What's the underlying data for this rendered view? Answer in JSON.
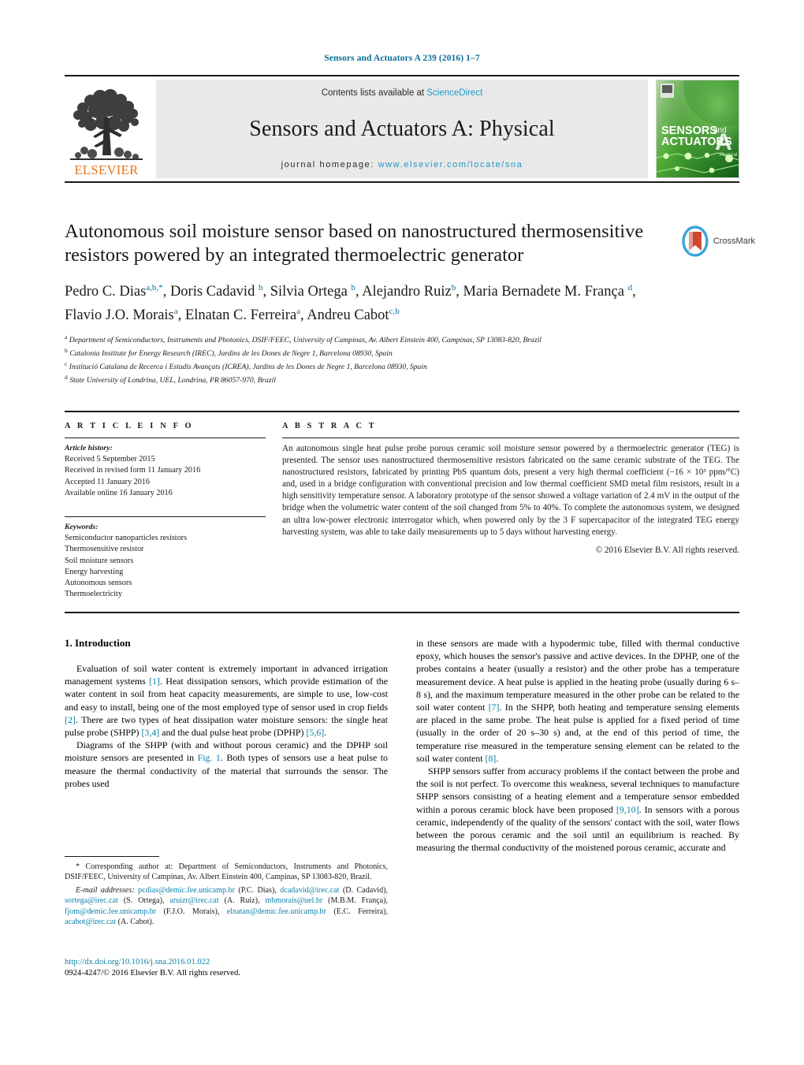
{
  "running_head": "Sensors and Actuators A 239 (2016) 1–7",
  "masthead": {
    "contents_prefix": "Contents lists available at ",
    "sciencedirect": "ScienceDirect",
    "journal_title": "Sensors and Actuators A: Physical",
    "homepage_prefix": "journal homepage:",
    "homepage_url": "www.elsevier.com/locate/sna",
    "publisher_wordmark": "ELSEVIER",
    "cover_line1": "SENSORS",
    "cover_and": "and",
    "cover_line2": "ACTUATORS",
    "cover_letter": "A",
    "cover_sub": "Physical"
  },
  "crossmark": {
    "label": "CrossMark"
  },
  "article": {
    "title": "Autonomous soil moisture sensor based on nanostructured thermosensitive resistors powered by an integrated thermoelectric generator",
    "authors_line1": "Pedro C. Dias",
    "authors_line1_sup": "a,b,*",
    "authors_html": "Pedro C. Dias<sup>a,b,</sup><sup>*</sup>, Doris Cadavid <sup>b</sup>, Silvia Ortega <sup>b</sup>, Alejandro Ruiz<sup>b</sup>, Maria Bernadete M. França <sup>d</sup>, Flavio J.O. Morais<sup>a</sup>, Elnatan C. Ferreira<sup>a</sup>, Andreu Cabot<sup>c,b</sup>",
    "affiliations": [
      {
        "mark": "a",
        "text": "Department of Semiconductors, Instruments and Photonics, DSIF/FEEC, University of Campinas, Av. Albert Einstein 400, Campinas, SP 13083-820, Brazil"
      },
      {
        "mark": "b",
        "text": "Catalonia Institute for Energy Research (IREC), Jardins de les Dones de Negre 1, Barcelona 08930, Spain"
      },
      {
        "mark": "c",
        "text": "Institució Catalana de Recerca i Estudis Avançats (ICREA), Jardins de les Dones de Negre 1, Barcelona 08930, Spain"
      },
      {
        "mark": "d",
        "text": "State University of Londrina, UEL, Londrina, PR 86057-970, Brazil"
      }
    ]
  },
  "article_info": {
    "heading": "A R T I C L E   I N F O",
    "history_label": "Article history:",
    "history": [
      "Received 5 September 2015",
      "Received in revised form 11 January 2016",
      "Accepted 11 January 2016",
      "Available online 16 January 2016"
    ],
    "keywords_label": "Keywords:",
    "keywords": [
      "Semiconductor nanoparticles resistors",
      "Thermosensitive resistor",
      "Soil moisture sensors",
      "Energy harvesting",
      "Autonomous sensors",
      "Thermoelectricity"
    ]
  },
  "abstract": {
    "heading": "A B S T R A C T",
    "text": "An autonomous single heat pulse probe porous ceramic soil moisture sensor powered by a thermoelectric generator (TEG) is presented. The sensor uses nanostructured thermosensitive resistors fabricated on the same ceramic substrate of the TEG. The nanostructured resistors, fabricated by printing PbS quantum dots, present a very high thermal coefficient (−16 × 10³ ppm/°C) and, used in a bridge configuration with conventional precision and low thermal coefficient SMD metal film resistors, result in a high sensitivity temperature sensor. A laboratory prototype of the sensor showed a voltage variation of 2.4 mV in the output of the bridge when the volumetric water content of the soil changed from 5% to 40%. To complete the autonomous system, we designed an ultra low-power electronic interrogator which, when powered only by the 3 F supercapacitor of the integrated TEG energy harvesting system, was able to take daily measurements up to 5 days without harvesting energy.",
    "copyright": "© 2016 Elsevier B.V. All rights reserved."
  },
  "body": {
    "section_heading": "1.  Introduction",
    "left_paragraph_1_html": "Evaluation of soil water content is extremely important in advanced irrigation management systems <span class=\"ref\">[1]</span>. Heat dissipation sensors, which provide estimation of the water content in soil from heat capacity measurements, are simple to use, low-cost and easy to install, being one of the most employed type of sensor used in crop fields <span class=\"ref\">[2]</span>. There are two types of heat dissipation water moisture sensors: the single heat pulse probe (SHPP) <span class=\"ref\">[3,4]</span> and the dual pulse heat probe (DPHP) <span class=\"ref\">[5,6]</span>.",
    "left_paragraph_2_html": "Diagrams of the SHPP (with and without porous ceramic) and the DPHP soil moisture sensors are presented in <span class=\"ref\">Fig. 1</span>. Both types of sensors use a heat pulse to measure the thermal conductivity of the material that surrounds the sensor. The probes used",
    "right_paragraph_1_html": "in these sensors are made with a hypodermic tube, filled with thermal conductive epoxy, which houses the sensor's passive and active devices. In the DPHP, one of the probes contains a heater (usually a resistor) and the other probe has a temperature measurement device. A heat pulse is applied in the heating probe (usually during 6 s–8 s), and the maximum temperature measured in the other probe can be related to the soil water content <span class=\"ref\">[7]</span>. In the SHPP, both heating and temperature sensing elements are placed in the same probe. The heat pulse is applied for a fixed period of time (usually in the order of 20 s–30 s) and, at the end of this period of time, the temperature rise measured in the temperature sensing element can be related to the soil water content <span class=\"ref\">[8]</span>.",
    "right_paragraph_2_html": "SHPP sensors suffer from accuracy problems if the contact between the probe and the soil is not perfect. To overcome this weakness, several techniques to manufacture SHPP sensors consisting of a heating element and a temperature sensor embedded within a porous ceramic block have been proposed <span class=\"ref\">[9,10]</span>. In sensors with a porous ceramic, independently of the quality of the sensors' contact with the soil, water flows between the porous ceramic and the soil until an equilibrium is reached. By measuring the thermal conductivity of the moistened porous ceramic, accurate and"
  },
  "footnote": {
    "corresponding_html": "* Corresponding author at: Department of Semiconductors, Instruments and Photonics, DSIF/FEEC, University of Campinas, Av. Albert Einstein 400, Campinas, SP 13083-820, Brazil.",
    "emails_html": "<span class=\"fn-em\">E-mail addresses:</span> <span class=\"mail\">pcdias@demic.fee.unicamp.br</span> (P.C. Dias), <span class=\"mail\">dcadavid@irec.cat</span> (D. Cadavid), <span class=\"mail\">sortega@irec.cat</span> (S. Ortega), <span class=\"mail\">aruizr@irec.cat</span> (A. Ruiz), <span class=\"mail\">mbmorais@uel.br</span> (M.B.M. França), <span class=\"mail\">fjom@demic.fee.unicamp.br</span> (F.J.O. Morais), <span class=\"mail\">elnatan@demic.fee.unicamp.br</span> (E.C. Ferreira), <span class=\"mail\">acabot@irec.cat</span> (A. Cabot)."
  },
  "footer": {
    "doi": "http://dx.doi.org/10.1016/j.sna.2016.01.022",
    "issn_line": "0924-4247/© 2016 Elsevier B.V. All rights reserved."
  },
  "colors": {
    "link_blue": "#0b7fa8",
    "header_blue": "#0b6e99",
    "sciencedirect_blue": "#2196c4",
    "elsevier_orange": "#e9711c",
    "rule_black": "#1a1a1a"
  }
}
